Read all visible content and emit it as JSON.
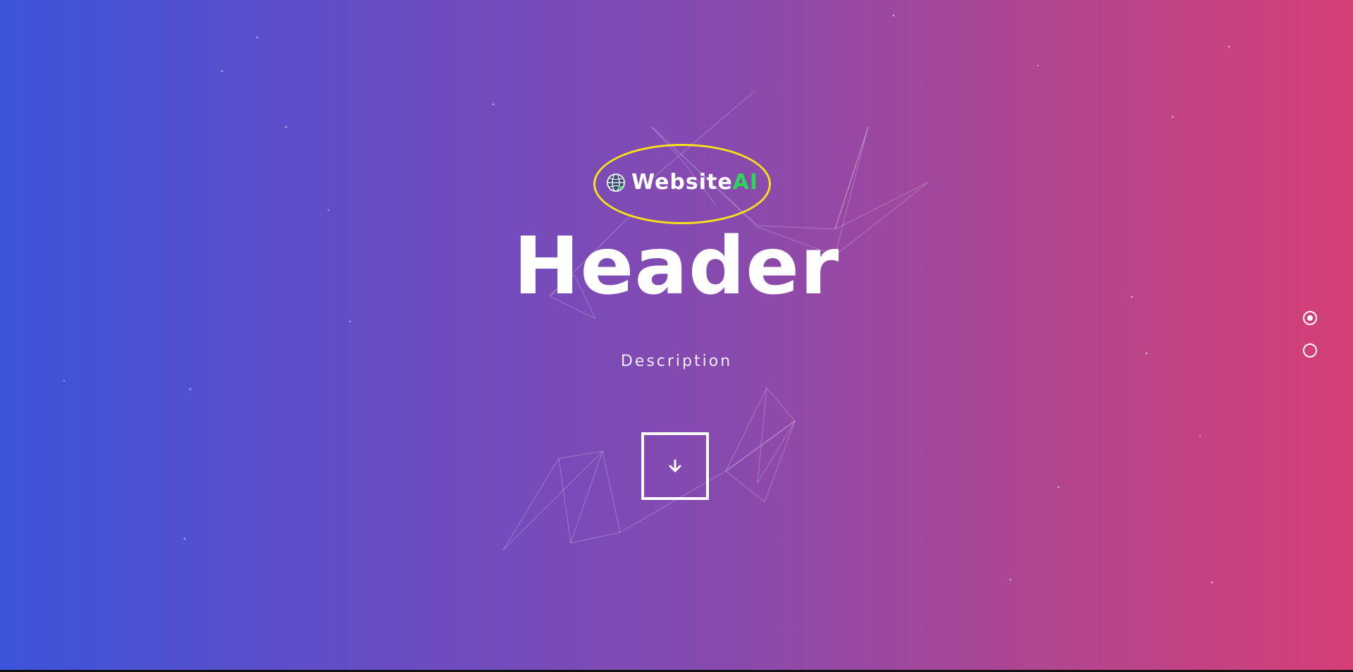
{
  "logo": {
    "text_main": "Website",
    "text_accent": "AI",
    "icon": "globe-icon",
    "accent_color": "#2ed35a",
    "highlight_color": "#f7e11a"
  },
  "hero": {
    "title": "Header",
    "description": "Description",
    "scroll_icon": "arrow-down-icon",
    "gradient": [
      "#3c54db",
      "#d63f77"
    ]
  },
  "section_nav": {
    "items": [
      {
        "label": "section-1",
        "active": true
      },
      {
        "label": "section-2",
        "active": false
      }
    ]
  }
}
